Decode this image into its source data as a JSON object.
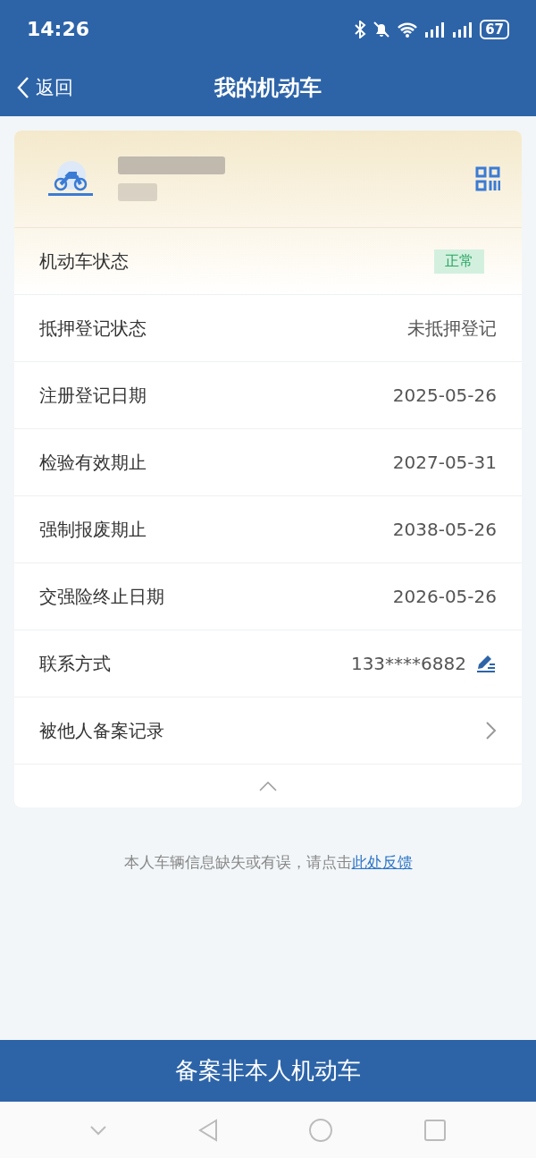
{
  "status_bar": {
    "time": "14:26",
    "battery": "67"
  },
  "nav": {
    "back": "返回",
    "title": "我的机动车"
  },
  "rows": [
    {
      "kind": "badge",
      "label": "机动车状态",
      "value": "正常"
    },
    {
      "kind": "text",
      "label": "抵押登记状态",
      "value": "未抵押登记"
    },
    {
      "kind": "text",
      "label": "注册登记日期",
      "value": "2025-05-26"
    },
    {
      "kind": "text",
      "label": "检验有效期止",
      "value": "2027-05-31"
    },
    {
      "kind": "text",
      "label": "强制报废期止",
      "value": "2038-05-26"
    },
    {
      "kind": "text",
      "label": "交强险终止日期",
      "value": "2026-05-26"
    },
    {
      "kind": "edit",
      "label": "联系方式",
      "value": "133****6882"
    },
    {
      "kind": "link",
      "label": "被他人备案记录"
    }
  ],
  "feedback": {
    "text": "本人车辆信息缺失或有误，请点击",
    "link": "此处反馈"
  },
  "action_button": "备案非本人机动车"
}
